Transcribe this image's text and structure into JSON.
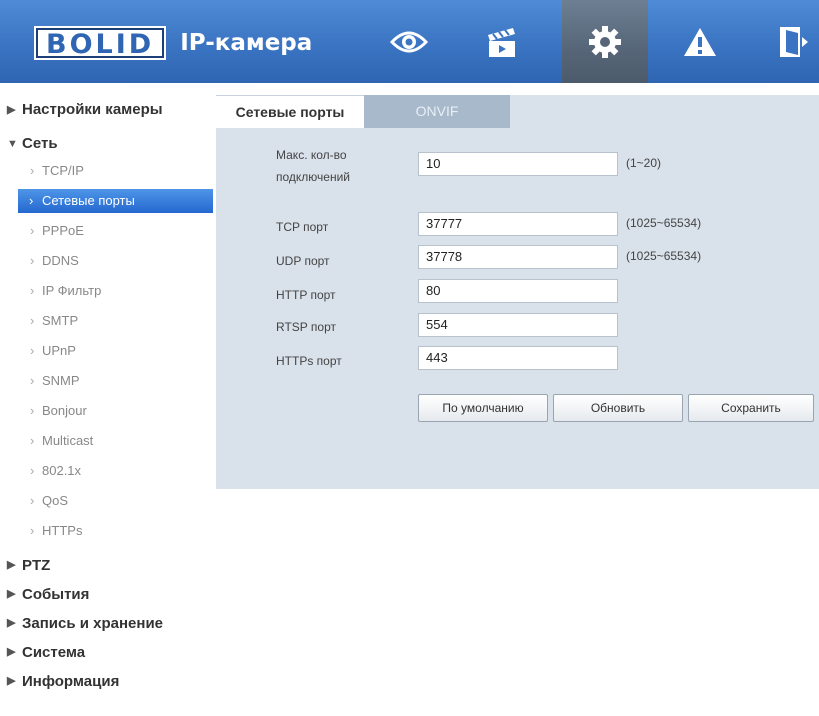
{
  "header": {
    "logo_text": "BOLID",
    "title": "IP-камера",
    "nav": [
      {
        "name": "live-view",
        "icon": "eye-icon"
      },
      {
        "name": "playback",
        "icon": "clapperboard-icon"
      },
      {
        "name": "setup",
        "icon": "gear-icon",
        "active": true
      },
      {
        "name": "alarm",
        "icon": "warning-icon"
      },
      {
        "name": "logout",
        "icon": "exit-door-icon"
      }
    ]
  },
  "sidebar": {
    "sections": {
      "camera": "Настройки камеры",
      "network": "Сеть",
      "ptz": "PTZ",
      "events": "События",
      "storage": "Запись и хранение",
      "system": "Система",
      "info": "Информация"
    },
    "network_items": [
      "TCP/IP",
      "Сетевые порты",
      "PPPoE",
      "DDNS",
      "IP Фильтр",
      "SMTP",
      "UPnP",
      "SNMP",
      "Bonjour",
      "Multicast",
      "802.1x",
      "QoS",
      "HTTPs"
    ],
    "active_item": "Сетевые порты"
  },
  "tabs": {
    "ports": "Сетевые порты",
    "onvif": "ONVIF"
  },
  "form": {
    "max_conn_label_1": "Макс. кол-во",
    "max_conn_label_2": "подключений",
    "max_conn_value": "10",
    "max_conn_range": "(1~20)",
    "tcp_label": "TCP порт",
    "tcp_value": "37777",
    "tcp_range": "(1025~65534)",
    "udp_label": "UDP порт",
    "udp_value": "37778",
    "udp_range": "(1025~65534)",
    "http_label": "HTTP порт",
    "http_value": "80",
    "rtsp_label": "RTSP порт",
    "rtsp_value": "554",
    "https_label": "HTTPs порт",
    "https_value": "443"
  },
  "buttons": {
    "default": "По умолчанию",
    "refresh": "Обновить",
    "save": "Сохранить"
  },
  "colors": {
    "header": "#3a74c2",
    "active_item": "#2468cf",
    "panel": "#d9e1ea"
  }
}
